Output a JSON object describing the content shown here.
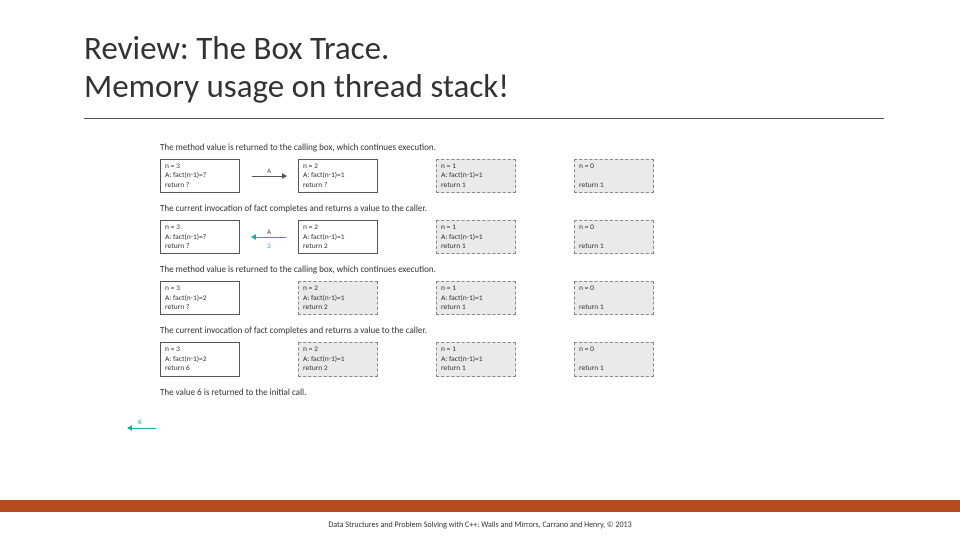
{
  "title_line1": "Review: The Box Trace.",
  "title_line2": "Memory usage on thread stack!",
  "captions": {
    "c1": "The method value is returned to the calling box, which continues execution.",
    "c2": "The current invocation of fact completes and returns a value to the caller.",
    "c3": "The method value is returned to the calling box, which continues execution.",
    "c4": "The current invocation of fact completes and returns a value to the caller.",
    "c5": "The value 6 is returned to the initial call."
  },
  "labels": {
    "A": "A",
    "two": "2",
    "six": "6"
  },
  "boxes": {
    "n3_q": "n = 3\nA: fact(n-1)=?\nreturn ?",
    "n3_2q": "n = 3\nA: fact(n-1)=2\nreturn ?",
    "n3_6": "n = 3\nA: fact(n-1)=2\nreturn 6",
    "n2_1": "n = 2\nA: fact(n-1)=1\nreturn ?",
    "n2_r2": "n = 2\nA: fact(n-1)=1\nreturn 2",
    "n1": "n = 1\nA: fact(n-1)=1\nreturn 1",
    "n0": "n = 0\n\nreturn 1"
  },
  "footer": "Data Structures and Problem Solving with C++: Walls and Mirrors, Carrano and Henry, © 2013"
}
